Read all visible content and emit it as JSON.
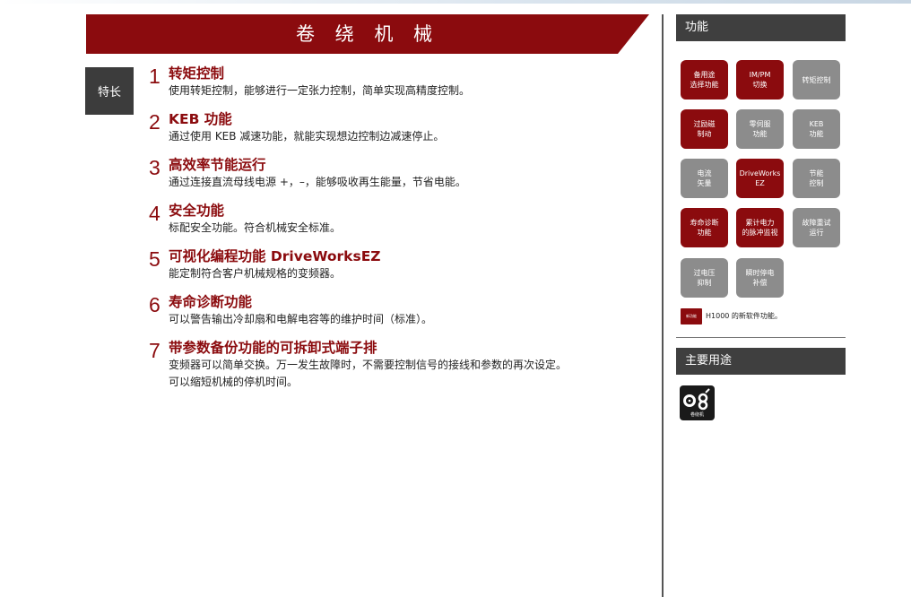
{
  "page": {
    "title": "卷 绕 机 械",
    "feature_tag": "特长"
  },
  "features": [
    {
      "num": "1",
      "title": "转矩控制",
      "desc": [
        "使用转矩控制，能够进行一定张力控制，简单实现高精度控制。"
      ]
    },
    {
      "num": "2",
      "title": "KEB 功能",
      "desc": [
        "通过使用 KEB 减速功能，就能实现想边控制边减速停止。"
      ]
    },
    {
      "num": "3",
      "title": "高效率节能运行",
      "desc": [
        "通过连接直流母线电源 +，–，能够吸收再生能量，节省电能。"
      ]
    },
    {
      "num": "4",
      "title": "安全功能",
      "desc": [
        "标配安全功能。符合机械安全标准。"
      ]
    },
    {
      "num": "5",
      "title": "可视化编程功能 DriveWorksEZ",
      "desc": [
        "能定制符合客户机械规格的变频器。"
      ]
    },
    {
      "num": "6",
      "title": "寿命诊断功能",
      "desc": [
        "可以警告输出冷却扇和电解电容等的维护时间（标准）。"
      ]
    },
    {
      "num": "7",
      "title": "带参数备份功能的可拆卸式端子排",
      "desc": [
        "变频器可以简单交换。万一发生故障时，不需要控制信号的接线和参数的再次设定。",
        "可以缩短机械的停机时间。"
      ]
    }
  ],
  "sidebar": {
    "functions_header": "功能",
    "tiles": [
      {
        "label": "备用途\n选择功能",
        "new": true
      },
      {
        "label": "IM/PM\n切换",
        "new": true
      },
      {
        "label": "转矩控制",
        "new": false
      },
      {
        "label": "过励磁\n制动",
        "new": true
      },
      {
        "label": "零伺服\n功能",
        "new": false
      },
      {
        "label": "KEB\n功能",
        "new": false
      },
      {
        "label": "电流\n矢量",
        "new": false
      },
      {
        "label": "DriveWorks\nEZ",
        "new": true
      },
      {
        "label": "节能\n控制",
        "new": false
      },
      {
        "label": "寿命诊断\n功能",
        "new": true
      },
      {
        "label": "累计电力\n的脉冲监视",
        "new": true
      },
      {
        "label": "故障重试\n运行",
        "new": false
      },
      {
        "label": "过电压\n抑制",
        "new": false
      },
      {
        "label": "瞬时停电\n补偿",
        "new": false
      }
    ],
    "legend_swatch_text": "新功能",
    "legend_text": "H1000 的新软件功能。",
    "applications_header": "主要用途",
    "app_icon_label": "卷绕机",
    "colors": {
      "accent": "#8b0b0e",
      "tile_gray": "#8c8c8c",
      "header_gray": "#3f3f3f"
    }
  }
}
